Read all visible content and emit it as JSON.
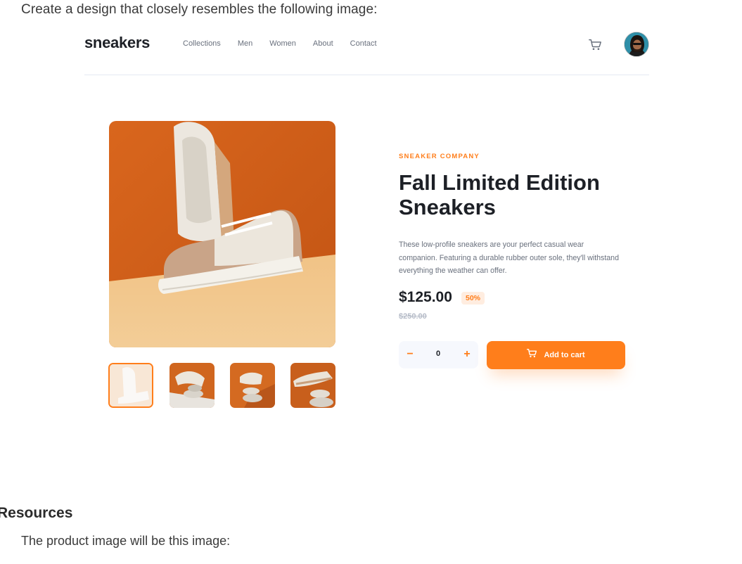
{
  "intro": "Create a design that closely resembles the following image:",
  "header": {
    "logo": "sneakers",
    "nav": [
      "Collections",
      "Men",
      "Women",
      "About",
      "Contact"
    ],
    "cart_icon": "cart-icon",
    "avatar_icon": "user-avatar"
  },
  "product": {
    "company": "SNEAKER COMPANY",
    "title": "Fall Limited Edition Sneakers",
    "description": "These low-profile sneakers are your perfect casual wear companion. Featuring a durable rubber outer sole, they'll withstand everything the weather can offer.",
    "price": "$125.00",
    "discount": "50%",
    "old_price": "$250.00",
    "quantity": "0",
    "minus_label": "−",
    "plus_label": "+",
    "add_to_cart": "Add to cart"
  },
  "colors": {
    "accent": "#ff7e1b",
    "accent_light": "#ffede0",
    "text_dark": "#1d2026",
    "text_gray": "#69707d"
  },
  "resources": {
    "heading": "Resources",
    "text": "The product image will be this image:"
  }
}
